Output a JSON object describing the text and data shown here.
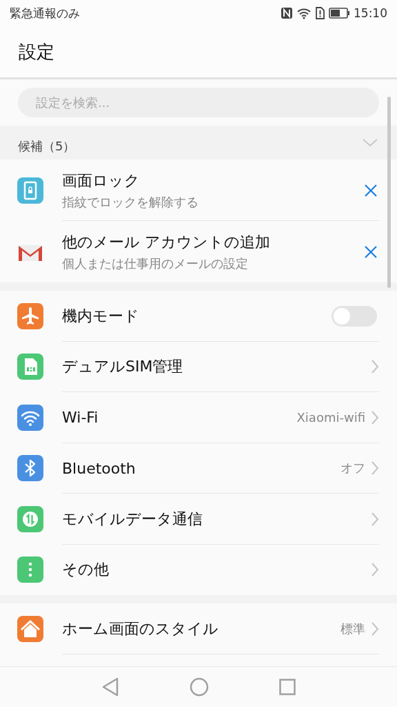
{
  "status_bar": {
    "carrier": "緊急通報のみ",
    "time": "15:10"
  },
  "title": "設定",
  "search": {
    "placeholder": "設定を検索..."
  },
  "suggestions": {
    "header": "候補（5）",
    "items": [
      {
        "title": "画面ロック",
        "subtitle": "指紋でロックを解除する"
      },
      {
        "title": "他のメール アカウントの追加",
        "subtitle": "個人または仕事用のメールの設定"
      }
    ]
  },
  "groups": [
    {
      "items": [
        {
          "kind": "toggle",
          "label": "機内モード",
          "on": false
        },
        {
          "kind": "link",
          "label": "デュアルSIM管理"
        },
        {
          "kind": "link",
          "label": "Wi-Fi",
          "value": "Xiaomi-wifi"
        },
        {
          "kind": "link",
          "label": "Bluetooth",
          "value": "オフ"
        },
        {
          "kind": "link",
          "label": "モバイルデータ通信"
        },
        {
          "kind": "link",
          "label": "その他"
        }
      ]
    },
    {
      "items": [
        {
          "kind": "link",
          "label": "ホーム画面のスタイル",
          "value": "標準"
        }
      ]
    }
  ]
}
